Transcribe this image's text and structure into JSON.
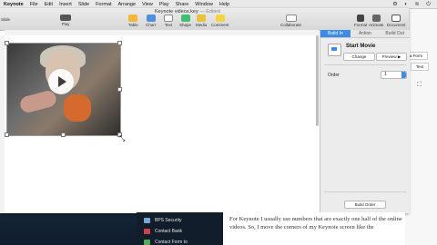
{
  "menubar": {
    "app": "Keynote",
    "items": [
      "File",
      "Edit",
      "Insert",
      "Slide",
      "Format",
      "Arrange",
      "View",
      "Play",
      "Share",
      "Window",
      "Help"
    ]
  },
  "window": {
    "title": "Keynote videos.key",
    "status": "— Edited"
  },
  "toolbar": {
    "slide": "Slide",
    "play": "Play",
    "table": "Table",
    "chart": "Chart",
    "text": "Text",
    "shape": "Shape",
    "media": "Media",
    "comment": "Comment",
    "collaborate": "Collaborate",
    "format": "Format",
    "animate": "Animate",
    "document": "Document"
  },
  "inspector": {
    "tabs": [
      "Build In",
      "Action",
      "Build Out"
    ],
    "effect_title": "Start Movie",
    "change_label": "Change",
    "preview_label": "Preview ▶",
    "order_label": "Order",
    "order_value": "1",
    "build_order_label": "Build Order"
  },
  "right_page": {
    "btn1": "a Form",
    "btn2": "Text"
  },
  "article": {
    "text": "For Keynote I usually use numbers that are exactly one half of the online videos. So, I move the corners of my Keynote screen like the"
  },
  "sidebar_list": {
    "items": [
      "BPS Security",
      "Contact Bank",
      "Contact Form to"
    ]
  },
  "colors": {
    "accent": "#3c8ce5"
  }
}
